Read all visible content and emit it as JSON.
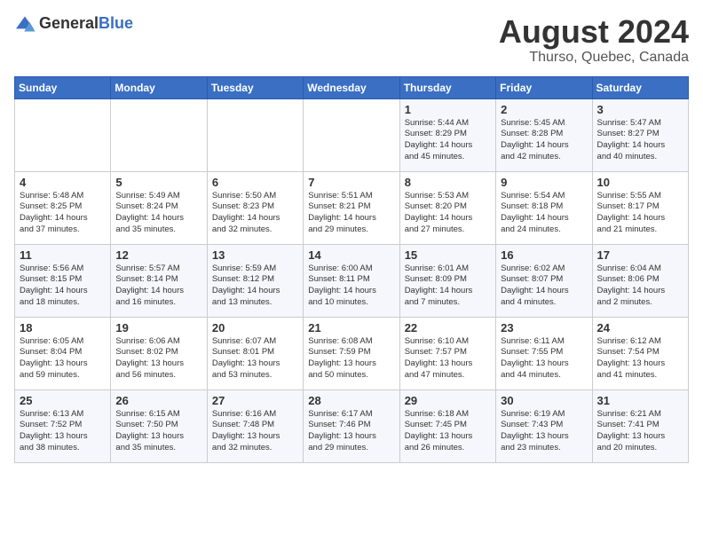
{
  "logo": {
    "general": "General",
    "blue": "Blue"
  },
  "calendar": {
    "title": "August 2024",
    "subtitle": "Thurso, Quebec, Canada"
  },
  "headers": [
    "Sunday",
    "Monday",
    "Tuesday",
    "Wednesday",
    "Thursday",
    "Friday",
    "Saturday"
  ],
  "weeks": [
    [
      {
        "day": "",
        "info": ""
      },
      {
        "day": "",
        "info": ""
      },
      {
        "day": "",
        "info": ""
      },
      {
        "day": "",
        "info": ""
      },
      {
        "day": "1",
        "info": "Sunrise: 5:44 AM\nSunset: 8:29 PM\nDaylight: 14 hours\nand 45 minutes."
      },
      {
        "day": "2",
        "info": "Sunrise: 5:45 AM\nSunset: 8:28 PM\nDaylight: 14 hours\nand 42 minutes."
      },
      {
        "day": "3",
        "info": "Sunrise: 5:47 AM\nSunset: 8:27 PM\nDaylight: 14 hours\nand 40 minutes."
      }
    ],
    [
      {
        "day": "4",
        "info": "Sunrise: 5:48 AM\nSunset: 8:25 PM\nDaylight: 14 hours\nand 37 minutes."
      },
      {
        "day": "5",
        "info": "Sunrise: 5:49 AM\nSunset: 8:24 PM\nDaylight: 14 hours\nand 35 minutes."
      },
      {
        "day": "6",
        "info": "Sunrise: 5:50 AM\nSunset: 8:23 PM\nDaylight: 14 hours\nand 32 minutes."
      },
      {
        "day": "7",
        "info": "Sunrise: 5:51 AM\nSunset: 8:21 PM\nDaylight: 14 hours\nand 29 minutes."
      },
      {
        "day": "8",
        "info": "Sunrise: 5:53 AM\nSunset: 8:20 PM\nDaylight: 14 hours\nand 27 minutes."
      },
      {
        "day": "9",
        "info": "Sunrise: 5:54 AM\nSunset: 8:18 PM\nDaylight: 14 hours\nand 24 minutes."
      },
      {
        "day": "10",
        "info": "Sunrise: 5:55 AM\nSunset: 8:17 PM\nDaylight: 14 hours\nand 21 minutes."
      }
    ],
    [
      {
        "day": "11",
        "info": "Sunrise: 5:56 AM\nSunset: 8:15 PM\nDaylight: 14 hours\nand 18 minutes."
      },
      {
        "day": "12",
        "info": "Sunrise: 5:57 AM\nSunset: 8:14 PM\nDaylight: 14 hours\nand 16 minutes."
      },
      {
        "day": "13",
        "info": "Sunrise: 5:59 AM\nSunset: 8:12 PM\nDaylight: 14 hours\nand 13 minutes."
      },
      {
        "day": "14",
        "info": "Sunrise: 6:00 AM\nSunset: 8:11 PM\nDaylight: 14 hours\nand 10 minutes."
      },
      {
        "day": "15",
        "info": "Sunrise: 6:01 AM\nSunset: 8:09 PM\nDaylight: 14 hours\nand 7 minutes."
      },
      {
        "day": "16",
        "info": "Sunrise: 6:02 AM\nSunset: 8:07 PM\nDaylight: 14 hours\nand 4 minutes."
      },
      {
        "day": "17",
        "info": "Sunrise: 6:04 AM\nSunset: 8:06 PM\nDaylight: 14 hours\nand 2 minutes."
      }
    ],
    [
      {
        "day": "18",
        "info": "Sunrise: 6:05 AM\nSunset: 8:04 PM\nDaylight: 13 hours\nand 59 minutes."
      },
      {
        "day": "19",
        "info": "Sunrise: 6:06 AM\nSunset: 8:02 PM\nDaylight: 13 hours\nand 56 minutes."
      },
      {
        "day": "20",
        "info": "Sunrise: 6:07 AM\nSunset: 8:01 PM\nDaylight: 13 hours\nand 53 minutes."
      },
      {
        "day": "21",
        "info": "Sunrise: 6:08 AM\nSunset: 7:59 PM\nDaylight: 13 hours\nand 50 minutes."
      },
      {
        "day": "22",
        "info": "Sunrise: 6:10 AM\nSunset: 7:57 PM\nDaylight: 13 hours\nand 47 minutes."
      },
      {
        "day": "23",
        "info": "Sunrise: 6:11 AM\nSunset: 7:55 PM\nDaylight: 13 hours\nand 44 minutes."
      },
      {
        "day": "24",
        "info": "Sunrise: 6:12 AM\nSunset: 7:54 PM\nDaylight: 13 hours\nand 41 minutes."
      }
    ],
    [
      {
        "day": "25",
        "info": "Sunrise: 6:13 AM\nSunset: 7:52 PM\nDaylight: 13 hours\nand 38 minutes."
      },
      {
        "day": "26",
        "info": "Sunrise: 6:15 AM\nSunset: 7:50 PM\nDaylight: 13 hours\nand 35 minutes."
      },
      {
        "day": "27",
        "info": "Sunrise: 6:16 AM\nSunset: 7:48 PM\nDaylight: 13 hours\nand 32 minutes."
      },
      {
        "day": "28",
        "info": "Sunrise: 6:17 AM\nSunset: 7:46 PM\nDaylight: 13 hours\nand 29 minutes."
      },
      {
        "day": "29",
        "info": "Sunrise: 6:18 AM\nSunset: 7:45 PM\nDaylight: 13 hours\nand 26 minutes."
      },
      {
        "day": "30",
        "info": "Sunrise: 6:19 AM\nSunset: 7:43 PM\nDaylight: 13 hours\nand 23 minutes."
      },
      {
        "day": "31",
        "info": "Sunrise: 6:21 AM\nSunset: 7:41 PM\nDaylight: 13 hours\nand 20 minutes."
      }
    ]
  ]
}
